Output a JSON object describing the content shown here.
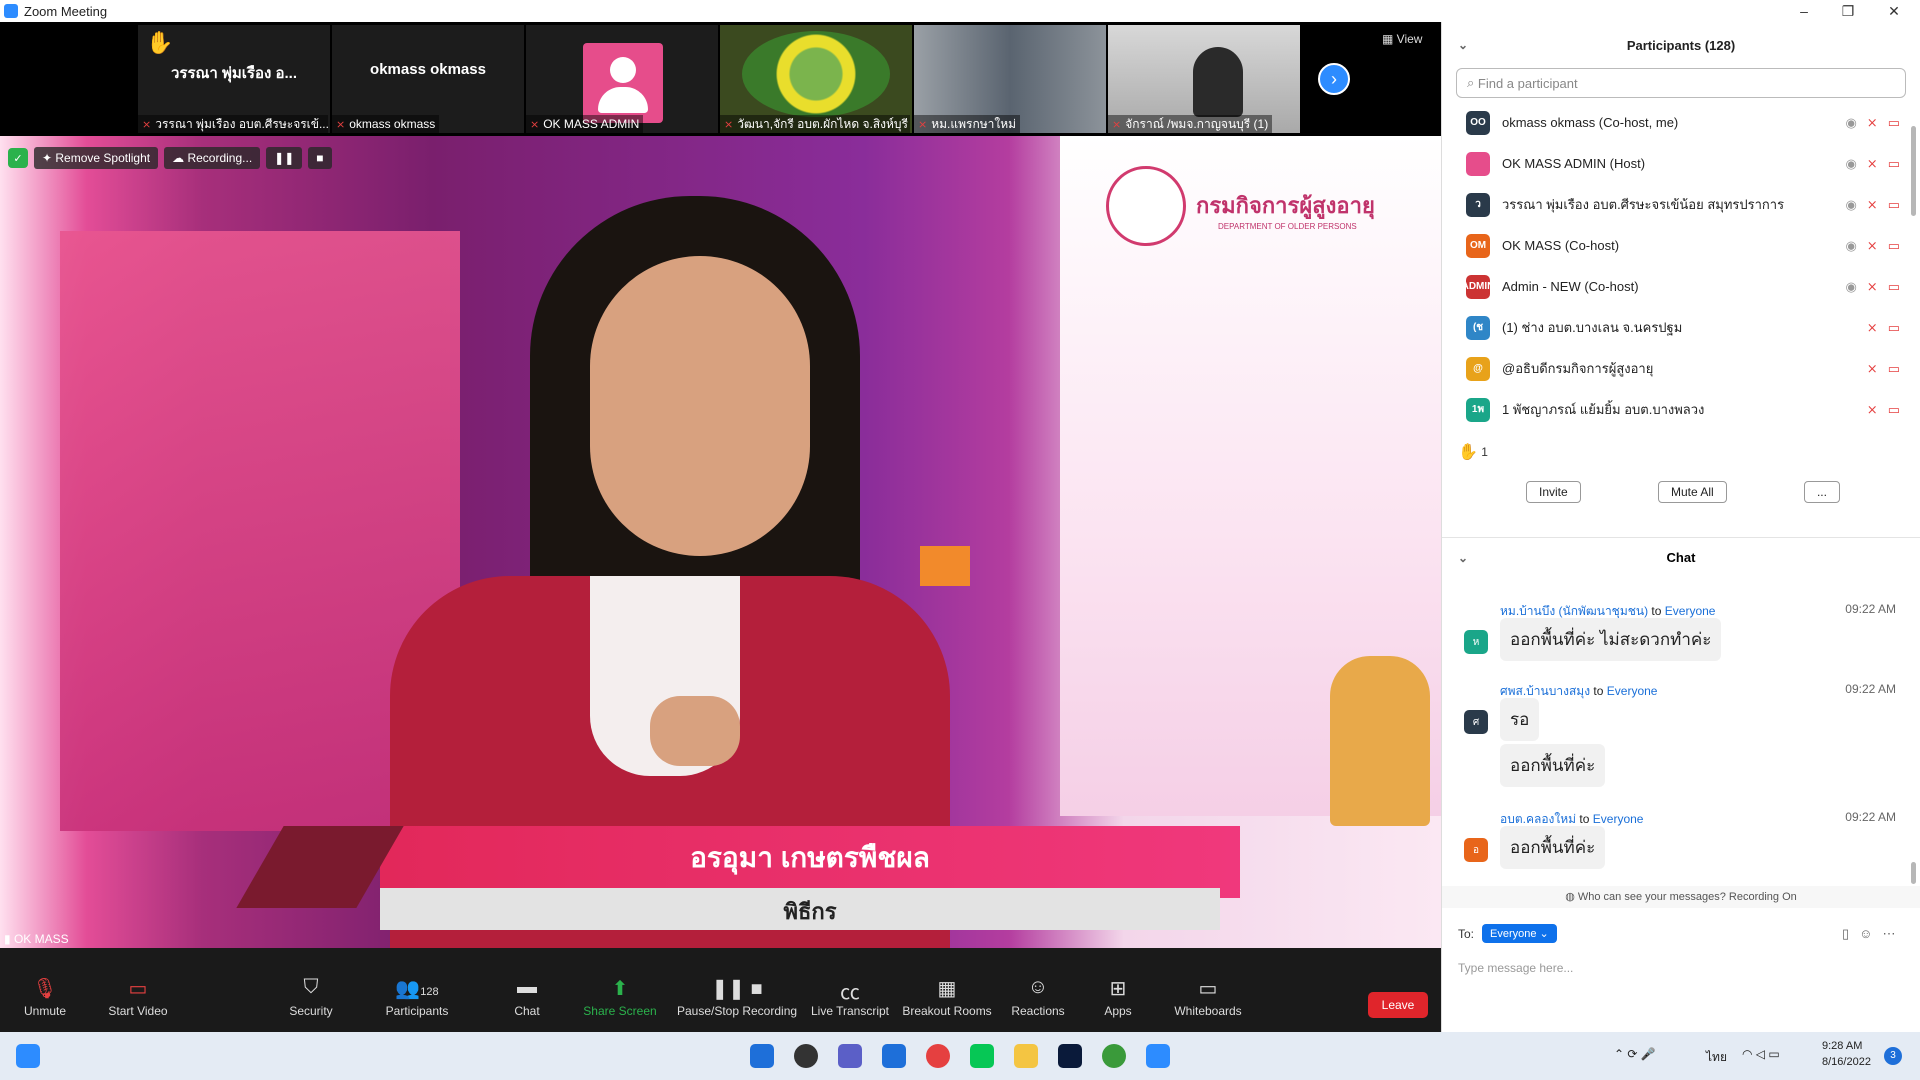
{
  "window": {
    "title": "Zoom Meeting"
  },
  "strip": {
    "tiles": [
      {
        "big": "วรรณา พุ่มเรือง อ...",
        "label": "วรรณา พุ่มเรือง อบต.ศีรษะจรเข้..."
      },
      {
        "big": "okmass okmass",
        "label": "okmass okmass"
      },
      {
        "big": "",
        "label": "OK MASS ADMIN"
      },
      {
        "big": "",
        "label": "วัฒนา,จักรี อบต.ผักไหด จ.สิงห์บุรี"
      },
      {
        "big": "",
        "label": "หม.แพรกษาใหม่"
      },
      {
        "big": "",
        "label": "จักราณ์ /พมจ.กาญจนบุรี (1)"
      }
    ],
    "view_label": "View"
  },
  "main": {
    "spotlight": "Remove Spotlight",
    "recording": "Recording...",
    "speaker_label": "OK MASS",
    "logo_text": "กรมกิจการผู้สูงอายุ",
    "logo_sub": "DEPARTMENT OF OLDER PERSONS",
    "caption_name": "อรอุมา เกษตรพืชผล",
    "caption_role": "พิธีกร"
  },
  "panel": {
    "participants_title": "Participants (128)",
    "search_placeholder": "Find a participant",
    "participants": [
      {
        "initials": "OO",
        "name": "okmass okmass (Co-host, me)",
        "color": "#2a3a4a"
      },
      {
        "initials": "",
        "name": "OK MASS ADMIN (Host)",
        "color": "#e64d8b"
      },
      {
        "initials": "ว",
        "name": "วรรณา พุ่มเรือง อบต.ศีรษะจรเข้น้อย สมุทรปราการ",
        "color": "#2a3a4a"
      },
      {
        "initials": "OM",
        "name": "OK MASS (Co-host)",
        "color": "#e8651a"
      },
      {
        "initials": "ADMIN",
        "name": "Admin - NEW (Co-host)",
        "color": "#cc3333"
      },
      {
        "initials": "(ช",
        "name": "(1) ช่าง อบต.บางเลน จ.นครปฐม",
        "color": "#2f86c7"
      },
      {
        "initials": "@",
        "name": "@อธิบดีกรมกิจการผู้สูงอายุ",
        "color": "#e8a21a"
      },
      {
        "initials": "1พ",
        "name": "1 พัชญาภรณ์ แย้มยิ้ม อบต.บางพลวง",
        "color": "#1aa689"
      }
    ],
    "raised_count": "1",
    "invite": "Invite",
    "mute_all": "Mute All",
    "more": "...",
    "chat_title": "Chat",
    "messages": [
      {
        "from": "หม.บ้านบึง (นักพัฒนาชุมชน)",
        "to": "Everyone",
        "time": "09:22 AM",
        "text": "ออกพื้นที่ค่ะ ไม่สะดวกทำค่ะ",
        "initial": "ห",
        "color": "#1aa689"
      },
      {
        "from": "ศพส.บ้านบางสมุง",
        "to": "Everyone",
        "time": "09:22 AM",
        "text": "รอ",
        "text2": "ออกพื้นที่ค่ะ",
        "initial": "ศ",
        "color": "#2a3a4a"
      },
      {
        "from": "อบต.คลองใหม่",
        "to": "Everyone",
        "time": "09:22 AM",
        "text": "ออกพื้นที่ค่ะ",
        "initial": "อ",
        "color": "#e8651a"
      }
    ],
    "to_word": "to",
    "notice": "Who can see your messages? Recording On",
    "to_label": "To:",
    "to_value": "Everyone",
    "input_placeholder": "Type message here..."
  },
  "toolbar": {
    "unmute": "Unmute",
    "start_video": "Start Video",
    "security": "Security",
    "participants": "Participants",
    "participants_count": "128",
    "chat": "Chat",
    "share": "Share Screen",
    "pause_rec": "Pause/Stop Recording",
    "transcript": "Live Transcript",
    "breakout": "Breakout Rooms",
    "reactions": "Reactions",
    "apps": "Apps",
    "whiteboards": "Whiteboards",
    "leave": "Leave"
  },
  "taskbar": {
    "lang": "ไทย",
    "time": "9:28 AM",
    "date": "8/16/2022",
    "badge": "3"
  }
}
